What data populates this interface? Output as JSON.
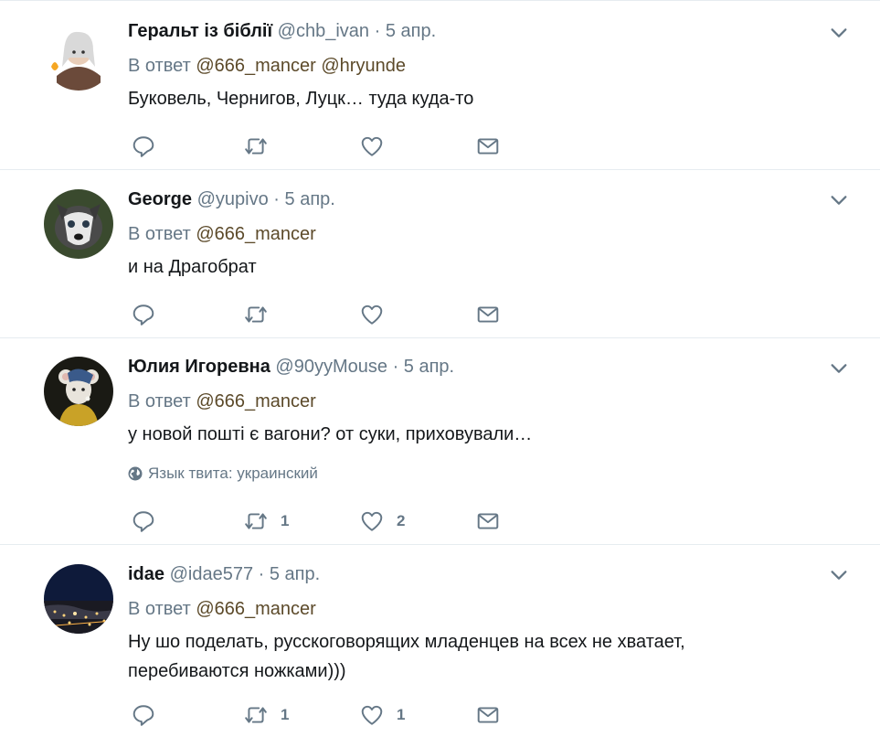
{
  "tweets": [
    {
      "fullname": "Геральт із біблії",
      "username": "@chb_ivan",
      "separator": "·",
      "time": "5 апр.",
      "reply_prefix": "В ответ",
      "mentions": [
        "@666_mancer",
        "@hryunde"
      ],
      "text": "Буковель, Чернигов, Луцк… туда куда-то",
      "retweets": "",
      "likes": "",
      "avatar_icon": "witcher-avatar-icon"
    },
    {
      "fullname": "George",
      "username": "@yupivo",
      "separator": "·",
      "time": "5 апр.",
      "reply_prefix": "В ответ",
      "mentions": [
        "@666_mancer"
      ],
      "text": "и на Драгобрат",
      "retweets": "",
      "likes": "",
      "avatar_icon": "husky-avatar-icon"
    },
    {
      "fullname": "Юлия Игоревна",
      "username": "@90yyMouse",
      "separator": "·",
      "time": "5 апр.",
      "reply_prefix": "В ответ",
      "mentions": [
        "@666_mancer"
      ],
      "text": "у новой пошті є вагони? от суки, приховували…",
      "language": "Язык твита: украинский",
      "retweets": "1",
      "likes": "2",
      "avatar_icon": "mouse-pearl-avatar-icon"
    },
    {
      "fullname": "idae",
      "username": "@idae577",
      "separator": "·",
      "time": "5 апр.",
      "reply_prefix": "В ответ",
      "mentions": [
        "@666_mancer"
      ],
      "text": "Ну шо поделать, русскоговорящих младенцев на всех не хватает, перебиваются ножками)))",
      "retweets": "1",
      "likes": "1",
      "avatar_icon": "night-city-avatar-icon"
    }
  ],
  "colors": {
    "secondary_text": "#657786",
    "mention": "#5c4a2a",
    "divider": "#e6ecf0"
  }
}
